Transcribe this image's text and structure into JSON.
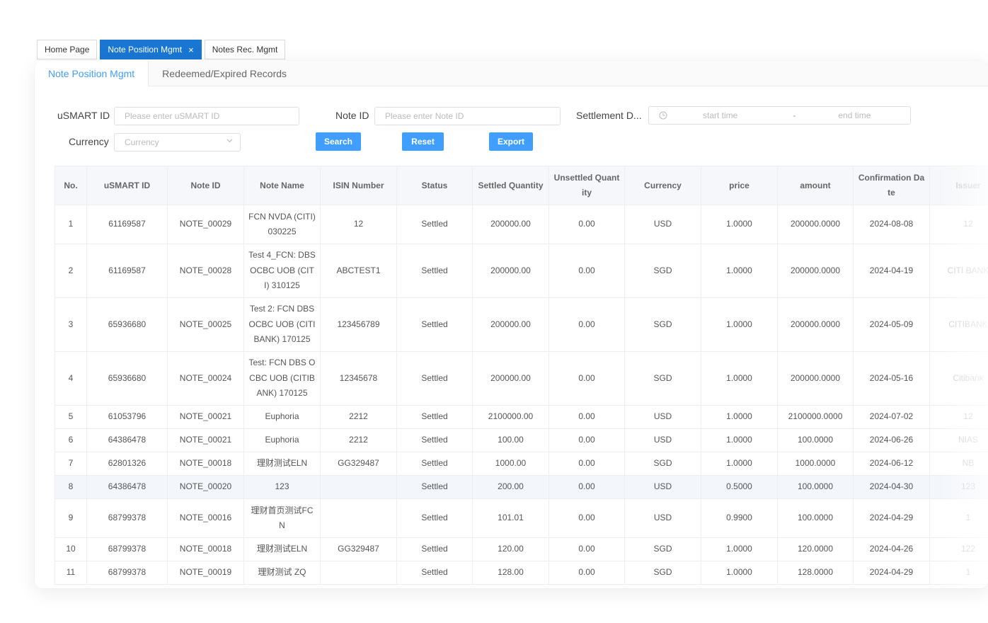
{
  "tabs": [
    {
      "label": "Home Page",
      "active": false
    },
    {
      "label": "Note Position Mgmt",
      "active": true,
      "closable": true
    },
    {
      "label": "Notes Rec. Mgmt",
      "active": false
    }
  ],
  "subtabs": [
    {
      "label": "Note Position Mgmt",
      "active": true
    },
    {
      "label": "Redeemed/Expired Records",
      "active": false
    }
  ],
  "filters": {
    "usmart_label": "uSMART ID",
    "usmart_placeholder": "Please enter uSMART ID",
    "noteid_label": "Note ID",
    "noteid_placeholder": "Please enter Note ID",
    "settlement_label": "Settlement D...",
    "start_placeholder": "start time",
    "range_sep": "-",
    "end_placeholder": "end time",
    "currency_label": "Currency",
    "currency_placeholder": "Currency",
    "search_label": "Search",
    "reset_label": "Reset",
    "export_label": "Export"
  },
  "colors": {
    "primary": "#409eff",
    "tab_active": "#1976d2"
  },
  "table": {
    "columns": [
      "No.",
      "uSMART ID",
      "Note ID",
      "Note Name",
      "ISIN Number",
      "Status",
      "Settled Quantity",
      "Unsettled Quant ity",
      "Currency",
      "price",
      "amount",
      "Confirmation Da te",
      "Issuer"
    ],
    "rows": [
      [
        "1",
        "61169587",
        "NOTE_00029",
        "FCN NVDA (CITI) 030225",
        "12",
        "Settled",
        "200000.00",
        "0.00",
        "USD",
        "1.0000",
        "200000.0000",
        "2024-08-08",
        "12"
      ],
      [
        "2",
        "61169587",
        "NOTE_00028",
        "Test 4_FCN: DBS OCBC UOB (CIT I) 310125",
        "ABCTEST1",
        "Settled",
        "200000.00",
        "0.00",
        "SGD",
        "1.0000",
        "200000.0000",
        "2024-04-19",
        "CITI BANK"
      ],
      [
        "3",
        "65936680",
        "NOTE_00025",
        "Test 2: FCN DBS OCBC UOB (CITI BANK) 170125",
        "123456789",
        "Settled",
        "200000.00",
        "0.00",
        "SGD",
        "1.0000",
        "200000.0000",
        "2024-05-09",
        "CITIBANK"
      ],
      [
        "4",
        "65936680",
        "NOTE_00024",
        "Test: FCN DBS O CBC UOB (CITIB ANK) 170125",
        "12345678",
        "Settled",
        "200000.00",
        "0.00",
        "SGD",
        "1.0000",
        "200000.0000",
        "2024-05-16",
        "Citibank"
      ],
      [
        "5",
        "61053796",
        "NOTE_00021",
        "Euphoria",
        "2212",
        "Settled",
        "2100000.00",
        "0.00",
        "USD",
        "1.0000",
        "2100000.0000",
        "2024-07-02",
        "12"
      ],
      [
        "6",
        "64386478",
        "NOTE_00021",
        "Euphoria",
        "2212",
        "Settled",
        "100.00",
        "0.00",
        "USD",
        "1.0000",
        "100.0000",
        "2024-06-26",
        "NIAS"
      ],
      [
        "7",
        "62801326",
        "NOTE_00018",
        "理财测试ELN",
        "GG329487",
        "Settled",
        "1000.00",
        "0.00",
        "SGD",
        "1.0000",
        "1000.0000",
        "2024-06-12",
        "NB"
      ],
      [
        "8",
        "64386478",
        "NOTE_00020",
        "123",
        "",
        "Settled",
        "200.00",
        "0.00",
        "USD",
        "0.5000",
        "100.0000",
        "2024-04-30",
        "123"
      ],
      [
        "9",
        "68799378",
        "NOTE_00016",
        "理财首页测试FC N",
        "",
        "Settled",
        "101.01",
        "0.00",
        "USD",
        "0.9900",
        "100.0000",
        "2024-04-29",
        "1"
      ],
      [
        "10",
        "68799378",
        "NOTE_00018",
        "理财测试ELN",
        "GG329487",
        "Settled",
        "120.00",
        "0.00",
        "SGD",
        "1.0000",
        "120.0000",
        "2024-04-26",
        "122"
      ],
      [
        "11",
        "68799378",
        "NOTE_00019",
        "理财测试 ZQ",
        "",
        "Settled",
        "128.00",
        "0.00",
        "SGD",
        "1.0000",
        "128.0000",
        "2024-04-29",
        "1"
      ]
    ]
  }
}
